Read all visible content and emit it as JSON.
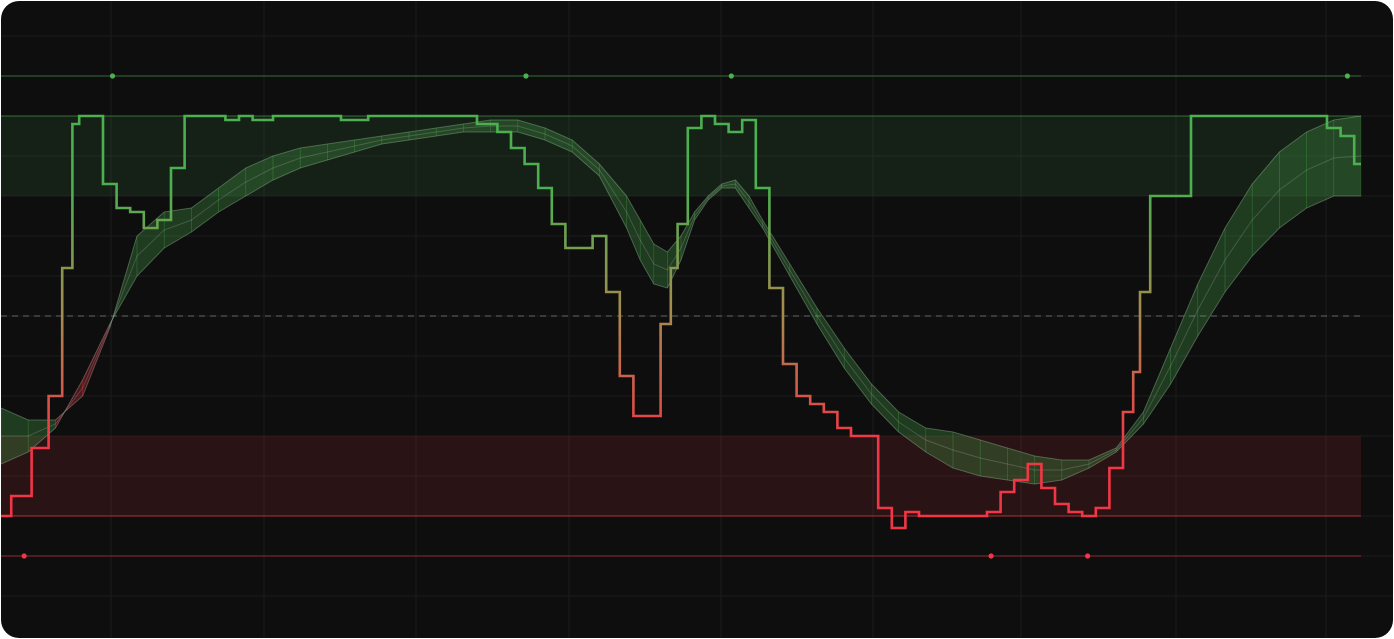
{
  "chart_data": {
    "type": "line",
    "title": "",
    "xlabel": "",
    "ylabel": "",
    "xlim": [
      0,
      100
    ],
    "ylim": [
      -20,
      120
    ],
    "grid": true,
    "colors": {
      "background": "#0e0e0e",
      "grid": "#1c1c1c",
      "bull": "#4caf50",
      "bear": "#f23645",
      "neutral": "#7a7a7a"
    },
    "levels": {
      "upper_extreme": 110,
      "overbought": 100,
      "overbought_zone_low": 80,
      "mid": 50,
      "oversold_zone_high": 20,
      "oversold": 0,
      "lower_extreme": -10
    },
    "series": [
      {
        "role": "oscillator",
        "x": [
          0,
          1.5,
          3,
          4,
          5,
          5.5,
          6,
          7,
          8,
          9,
          10,
          11,
          12,
          13,
          14,
          15,
          16,
          17,
          18,
          19,
          21,
          22,
          24,
          26,
          28,
          30,
          32,
          34,
          36,
          37,
          38,
          39,
          40,
          41,
          42,
          43,
          44,
          45,
          46,
          47,
          48,
          49,
          49.5,
          50,
          51,
          52,
          53,
          54,
          55,
          56,
          57,
          58,
          59,
          60,
          61,
          62,
          63,
          64,
          65,
          66,
          67,
          68,
          69,
          70,
          71,
          72,
          73,
          74,
          75,
          76,
          77,
          78,
          79,
          80,
          81,
          82,
          83,
          83.5,
          84,
          85,
          90,
          95,
          96,
          97,
          98,
          99,
          100
        ],
        "values": [
          0,
          5,
          17,
          30,
          62,
          98,
          100,
          100,
          83,
          77,
          76,
          72,
          74,
          87,
          100,
          100,
          100,
          99,
          100,
          99,
          100,
          100,
          100,
          99,
          100,
          100,
          100,
          100,
          98,
          96,
          92,
          88,
          82,
          73,
          67,
          67,
          70,
          56,
          35,
          25,
          25,
          48,
          62,
          73,
          97,
          100,
          98,
          96,
          99,
          82,
          57,
          38,
          30,
          28,
          26,
          22,
          20,
          20,
          2,
          -3,
          1,
          0,
          0,
          0,
          0,
          0,
          1,
          6,
          9,
          13,
          7,
          3,
          1,
          0,
          2,
          12,
          26,
          36,
          56,
          80,
          100,
          100,
          100,
          100,
          97,
          95,
          88
        ]
      },
      {
        "role": "signal_fast",
        "x": [
          0,
          2,
          4,
          6,
          8,
          10,
          12,
          14,
          16,
          18,
          20,
          22,
          24,
          26,
          28,
          30,
          32,
          34,
          36,
          38,
          40,
          42,
          44,
          46,
          47,
          48,
          49,
          50,
          51,
          52,
          53,
          54,
          55,
          56,
          58,
          60,
          62,
          64,
          66,
          68,
          70,
          72,
          74,
          76,
          78,
          80,
          82,
          84,
          86,
          88,
          90,
          92,
          94,
          96,
          98,
          100
        ],
        "values": [
          27,
          24,
          24,
          30,
          47,
          70,
          76,
          77,
          82,
          87,
          90,
          92,
          93,
          94,
          95,
          96,
          97,
          98,
          99,
          99,
          97,
          94,
          88,
          80,
          74,
          68,
          66,
          70,
          76,
          80,
          83,
          84,
          80,
          74,
          63,
          52,
          42,
          33,
          26,
          22,
          21,
          19,
          17,
          15,
          14,
          14,
          17,
          26,
          42,
          58,
          72,
          83,
          91,
          96,
          99,
          100
        ]
      },
      {
        "role": "signal_slow",
        "x": [
          0,
          2,
          4,
          6,
          8,
          10,
          12,
          14,
          16,
          18,
          20,
          22,
          24,
          26,
          28,
          30,
          32,
          34,
          36,
          38,
          40,
          42,
          44,
          46,
          47,
          48,
          49,
          50,
          51,
          52,
          53,
          54,
          55,
          56,
          58,
          60,
          62,
          64,
          66,
          68,
          70,
          72,
          74,
          76,
          78,
          80,
          82,
          84,
          86,
          88,
          90,
          92,
          94,
          96,
          98,
          100
        ],
        "values": [
          13,
          16,
          22,
          34,
          48,
          60,
          67,
          71,
          76,
          80,
          84,
          87,
          89,
          91,
          93,
          94,
          95,
          96,
          96,
          96,
          94,
          91,
          85,
          72,
          64,
          58,
          57,
          64,
          74,
          79,
          82,
          82,
          77,
          72,
          60,
          48,
          37,
          28,
          21,
          16,
          12,
          10,
          9,
          8,
          9,
          12,
          16,
          23,
          33,
          45,
          56,
          65,
          72,
          77,
          80,
          80
        ]
      }
    ]
  }
}
